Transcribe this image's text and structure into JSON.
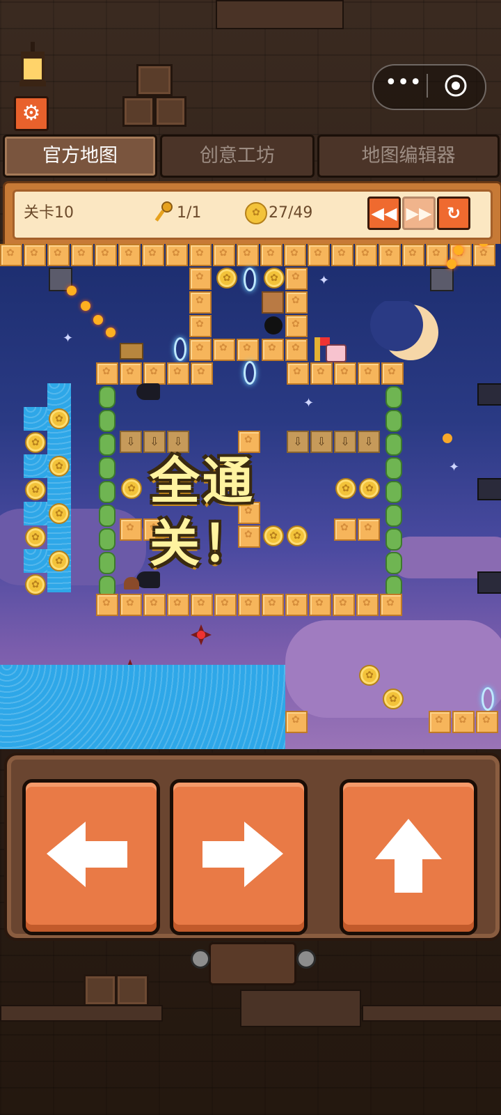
{
  "capsule": {
    "more_icon": "more-dots-icon",
    "close_icon": "target-circle-icon"
  },
  "settings": {
    "icon": "gear-icon"
  },
  "tabs": [
    {
      "label": "官方地图",
      "active": true
    },
    {
      "label": "创意工坊",
      "active": false
    },
    {
      "label": "地图编辑器",
      "active": false
    }
  ],
  "status": {
    "level": "关卡10",
    "keys": "1/1",
    "coins": "27/49",
    "key_icon": "key-icon",
    "coin_icon": "paw-coin-icon"
  },
  "playback": {
    "rewind_icon": "rewind-icon",
    "forward_icon": "fast-forward-icon",
    "restart_icon": "restart-icon"
  },
  "game": {
    "banner": "全通关！"
  },
  "controls": {
    "left_icon": "left-arrow-icon",
    "right_icon": "right-arrow-icon",
    "jump_icon": "up-arrow-icon"
  },
  "colors": {
    "accent": "#e97a46",
    "panel": "#fbe7c2",
    "block": "#f6b55b",
    "water": "#2ea7e8"
  }
}
